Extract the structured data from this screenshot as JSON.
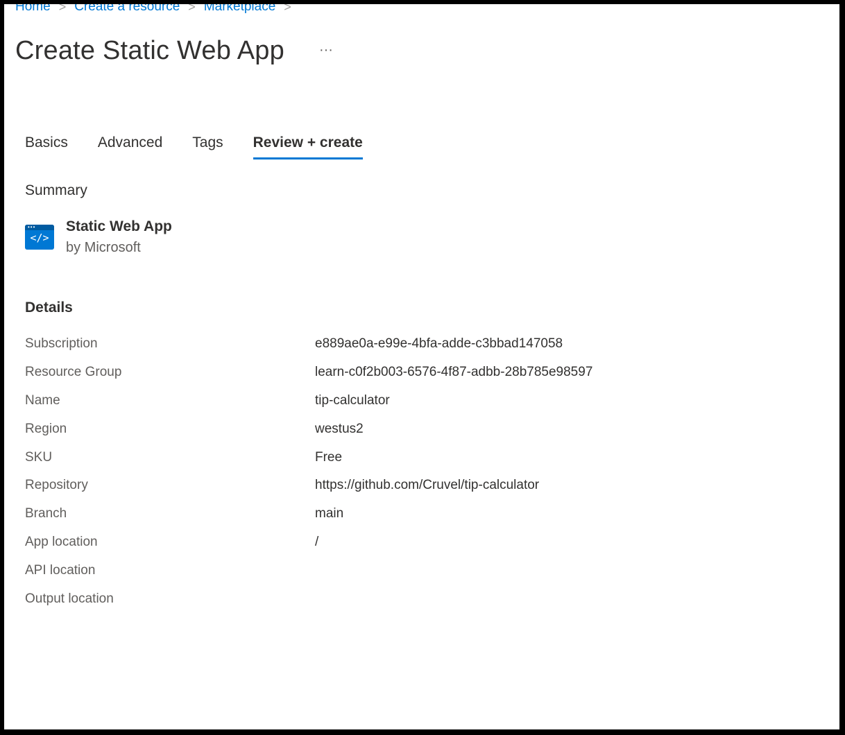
{
  "breadcrumb": {
    "items": [
      "Home",
      "Create a resource",
      "Marketplace"
    ],
    "separator": ">"
  },
  "page": {
    "title": "Create Static Web App",
    "more_label": "···"
  },
  "tabs": [
    {
      "label": "Basics",
      "active": false
    },
    {
      "label": "Advanced",
      "active": false
    },
    {
      "label": "Tags",
      "active": false
    },
    {
      "label": "Review + create",
      "active": true
    }
  ],
  "summary": {
    "label": "Summary",
    "product_name": "Static Web App",
    "product_vendor": "by Microsoft",
    "icon_glyph": "</>"
  },
  "details": {
    "heading": "Details",
    "rows": [
      {
        "label": "Subscription",
        "value": "e889ae0a-e99e-4bfa-adde-c3bbad147058"
      },
      {
        "label": "Resource Group",
        "value": "learn-c0f2b003-6576-4f87-adbb-28b785e98597"
      },
      {
        "label": "Name",
        "value": "tip-calculator"
      },
      {
        "label": "Region",
        "value": "westus2"
      },
      {
        "label": "SKU",
        "value": "Free"
      },
      {
        "label": "Repository",
        "value": "https://github.com/Cruvel/tip-calculator"
      },
      {
        "label": "Branch",
        "value": "main"
      },
      {
        "label": "App location",
        "value": "/"
      },
      {
        "label": "API location",
        "value": ""
      },
      {
        "label": "Output location",
        "value": ""
      }
    ]
  },
  "colors": {
    "accent": "#0078d4",
    "text": "#323130",
    "muted": "#605e5c"
  }
}
